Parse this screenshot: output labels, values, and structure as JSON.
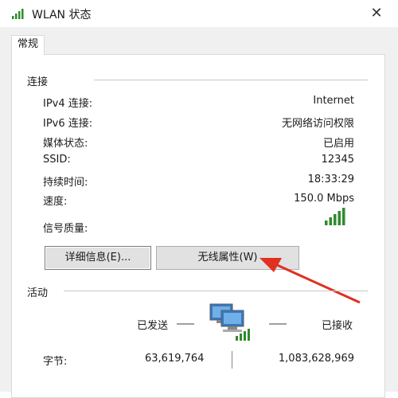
{
  "window": {
    "title": "WLAN 状态",
    "close_icon": "close-icon"
  },
  "tabs": [
    {
      "label": "常规"
    }
  ],
  "connection": {
    "section_label": "连接",
    "rows": [
      {
        "label": "IPv4 连接:",
        "value": "Internet"
      },
      {
        "label": "IPv6 连接:",
        "value": "无网络访问权限"
      },
      {
        "label": "媒体状态:",
        "value": "已启用"
      },
      {
        "label": "SSID:",
        "value": "12345"
      },
      {
        "label": "持续时间:",
        "value": "18:33:29"
      },
      {
        "label": "速度:",
        "value": "150.0 Mbps"
      }
    ],
    "signal_label": "信号质量:",
    "signal_bars": 5,
    "signal_total": 5
  },
  "buttons": {
    "details": "详细信息(E)...",
    "wireless_props": "无线属性(W)"
  },
  "activity": {
    "section_label": "活动",
    "sent_label": "已发送",
    "received_label": "已接收",
    "bytes_label": "字节:",
    "bytes_sent": "63,619,764",
    "bytes_received": "1,083,628,969"
  },
  "colors": {
    "signal_green": "#2e8b2e",
    "arrow_red": "#e03020",
    "panel_bg": "#ffffff",
    "window_bg": "#f0f0f0"
  }
}
